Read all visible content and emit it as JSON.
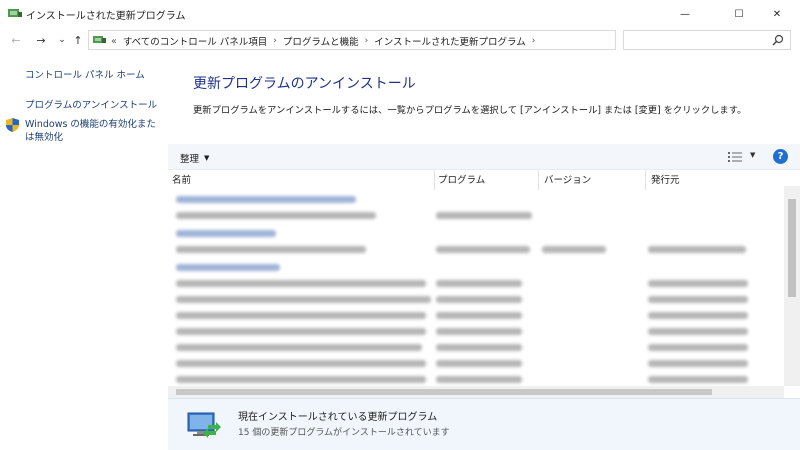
{
  "window": {
    "title": "インストールされた更新プログラム",
    "minimize": "—",
    "maximize": "☐",
    "close": "✕"
  },
  "nav": {
    "back": "←",
    "forward": "→",
    "recent": "⌄",
    "up": "↑",
    "overflow": "«",
    "breadcrumbs": [
      "すべてのコントロール パネル項目",
      "プログラムと機能",
      "インストールされた更新プログラム"
    ],
    "separator": "›",
    "refresh": "↻",
    "search_placeholder": ""
  },
  "sidebar": {
    "home": "コントロール パネル ホーム",
    "uninstall_program": "プログラムのアンインストール",
    "windows_features": "Windows の機能の有効化または無効化"
  },
  "main": {
    "title": "更新プログラムのアンインストール",
    "description": "更新プログラムをアンインストールするには、一覧からプログラムを選択して [アンインストール] または [変更] をクリックします。"
  },
  "toolbar": {
    "organize": "整理",
    "caret": "▼",
    "help": "?"
  },
  "columns": [
    "名前",
    "プログラム",
    "バージョン",
    "発行元"
  ],
  "details": {
    "title": "現在インストールされている更新プログラム",
    "subtitle": "15 個の更新プログラムがインストールされています"
  },
  "colors": {
    "link": "#1e3f7a",
    "heading": "#1e3287",
    "toolbar_bg": "#f3f6fb",
    "details_bg": "#f1f5fc",
    "help_blue": "#1f6fd1"
  }
}
